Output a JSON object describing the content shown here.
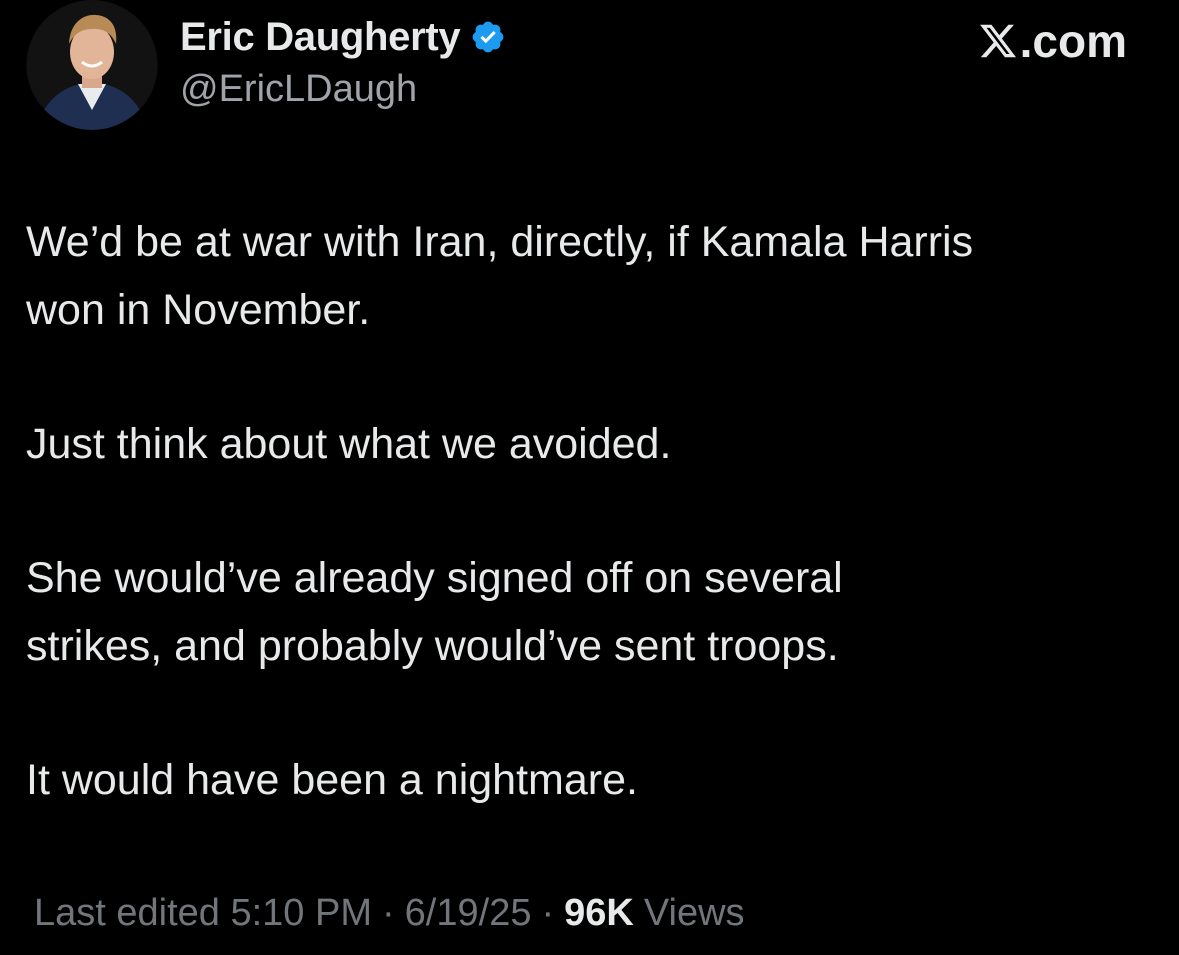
{
  "author": {
    "display_name": "Eric Daugherty",
    "handle": "@EricLDaugh",
    "verified": true
  },
  "site": {
    "label": ".com",
    "logo": "x-logo"
  },
  "tweet": {
    "paragraphs": [
      "We’d be at war with Iran, directly, if Kamala Harris\nwon in November.",
      "Just think about what we avoided.",
      "She would’ve already signed off on several\nstrikes, and probably would’ve sent troops.",
      "It would have been a nightmare."
    ]
  },
  "meta": {
    "edited_label": "Last edited",
    "time": "5:10 PM",
    "date": "6/19/25",
    "separator": "·",
    "views_count": "96K",
    "views_label": "Views"
  },
  "colors": {
    "background": "#000000",
    "primary_text": "#e7e9ea",
    "secondary_text": "#72767b",
    "verified_blue": "#1d9bf0"
  }
}
